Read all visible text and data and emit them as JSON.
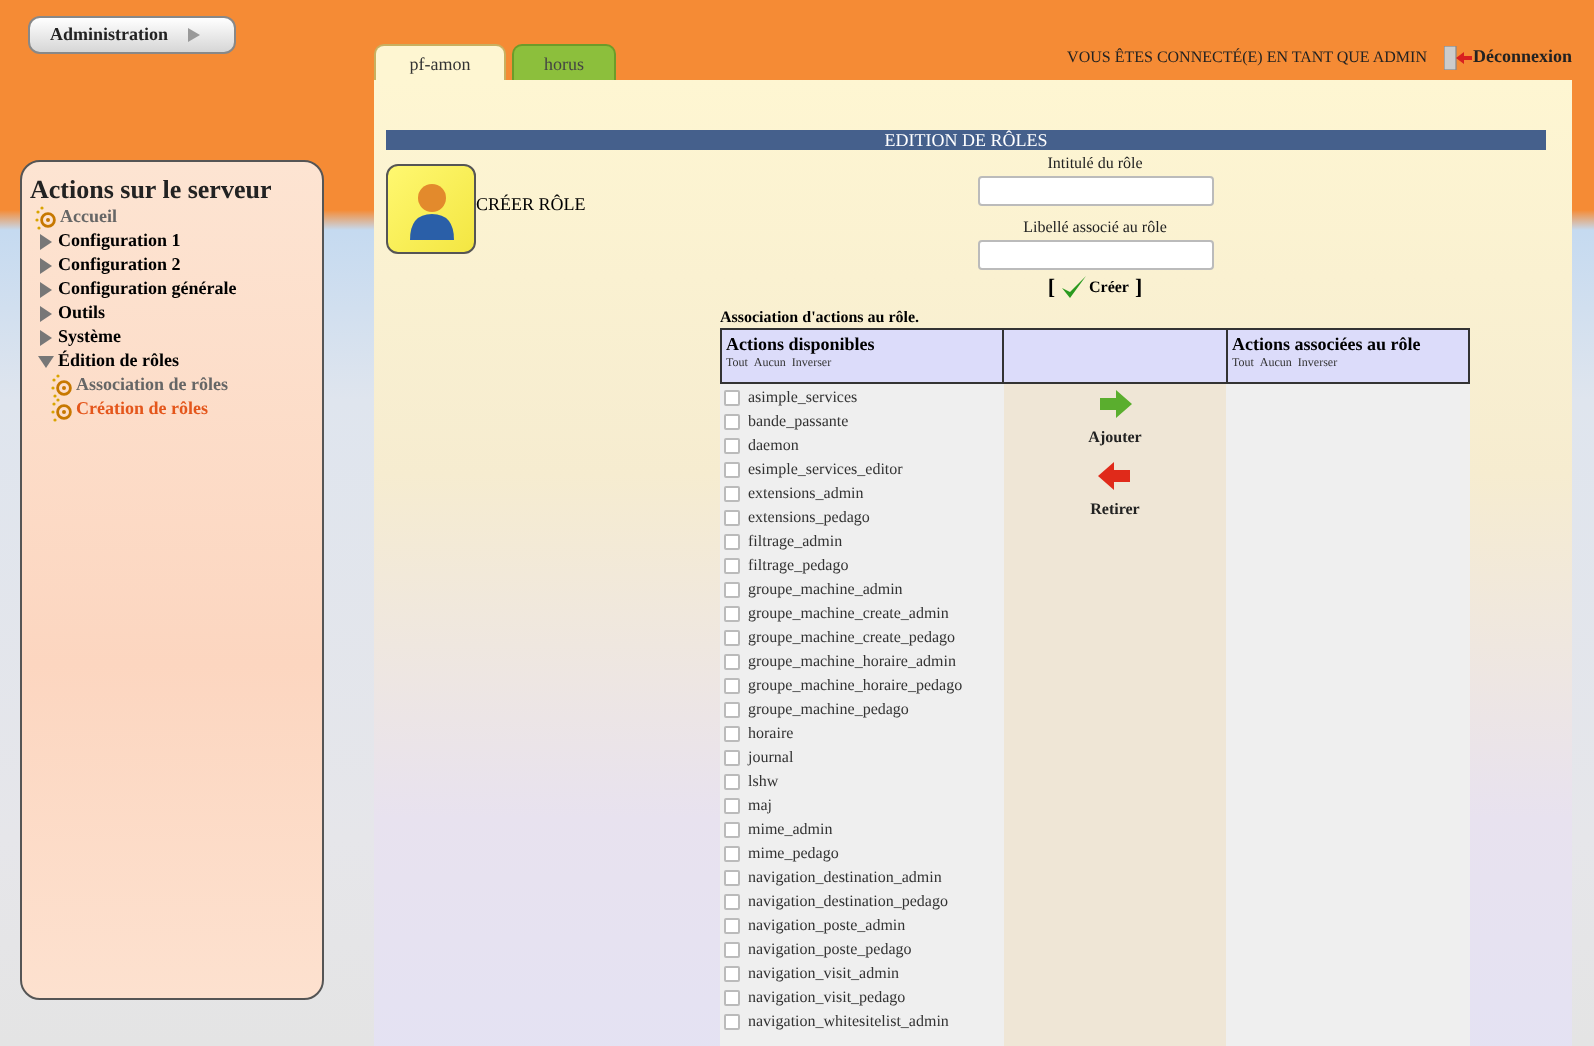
{
  "top_button": {
    "label": "Administration"
  },
  "tabs": [
    {
      "label": "pf-amon",
      "selected": true
    },
    {
      "label": "horus",
      "selected": false
    }
  ],
  "user_status": "VOUS ÊTES CONNECTÉ(E) EN TANT QUE ADMIN",
  "logout": "Déconnexion",
  "sidebar": {
    "title": "Actions sur le serveur",
    "items": [
      {
        "kind": "link",
        "label": "Accueil",
        "selected": false
      },
      {
        "kind": "folder",
        "label": "Configuration 1",
        "expanded": false
      },
      {
        "kind": "folder",
        "label": "Configuration 2",
        "expanded": false
      },
      {
        "kind": "folder",
        "label": "Configuration générale",
        "expanded": false
      },
      {
        "kind": "folder",
        "label": "Outils",
        "expanded": false
      },
      {
        "kind": "folder",
        "label": "Système",
        "expanded": false
      },
      {
        "kind": "folder",
        "label": "Édition de rôles",
        "expanded": true,
        "children": [
          {
            "kind": "link",
            "label": "Association de rôles",
            "selected": false
          },
          {
            "kind": "link",
            "label": "Création de rôles",
            "selected": true
          }
        ]
      }
    ]
  },
  "section_title": "EDITION DE RÔLES",
  "page_heading": "CRÉER RÔLE",
  "form": {
    "fields": [
      {
        "label": "Intitulé du rôle"
      },
      {
        "label": "Libellé associé au rôle"
      }
    ],
    "submit": "Créer",
    "bracket_open": "[",
    "bracket_close": "]"
  },
  "association": {
    "title": "Association d'actions au rôle.",
    "available": {
      "heading": "Actions disponibles",
      "links": [
        "Tout",
        "Aucun",
        "Inverser"
      ]
    },
    "assigned": {
      "heading": "Actions associées au rôle",
      "links": [
        "Tout",
        "Aucun",
        "Inverser"
      ]
    },
    "add": "Ajouter",
    "remove": "Retirer",
    "actions": [
      {
        "label": "asimple_services",
        "checked": false
      },
      {
        "label": "bande_passante",
        "checked": false
      },
      {
        "label": "daemon",
        "checked": false
      },
      {
        "label": "esimple_services_editor",
        "checked": false
      },
      {
        "label": "extensions_admin",
        "checked": false
      },
      {
        "label": "extensions_pedago",
        "checked": false
      },
      {
        "label": "filtrage_admin",
        "checked": false
      },
      {
        "label": "filtrage_pedago",
        "checked": false
      },
      {
        "label": "groupe_machine_admin",
        "checked": false
      },
      {
        "label": "groupe_machine_create_admin",
        "checked": false
      },
      {
        "label": "groupe_machine_create_pedago",
        "checked": false
      },
      {
        "label": "groupe_machine_horaire_admin",
        "checked": false
      },
      {
        "label": "groupe_machine_horaire_pedago",
        "checked": false
      },
      {
        "label": "groupe_machine_pedago",
        "checked": false
      },
      {
        "label": "horaire",
        "checked": false
      },
      {
        "label": "journal",
        "checked": false
      },
      {
        "label": "lshw",
        "checked": false
      },
      {
        "label": "maj",
        "checked": false
      },
      {
        "label": "mime_admin",
        "checked": false
      },
      {
        "label": "mime_pedago",
        "checked": false
      },
      {
        "label": "navigation_destination_admin",
        "checked": false
      },
      {
        "label": "navigation_destination_pedago",
        "checked": false
      },
      {
        "label": "navigation_poste_admin",
        "checked": false
      },
      {
        "label": "navigation_poste_pedago",
        "checked": false
      },
      {
        "label": "navigation_visit_admin",
        "checked": false
      },
      {
        "label": "navigation_visit_pedago",
        "checked": false
      },
      {
        "label": "navigation_whitesitelist_admin",
        "checked": false
      }
    ]
  }
}
